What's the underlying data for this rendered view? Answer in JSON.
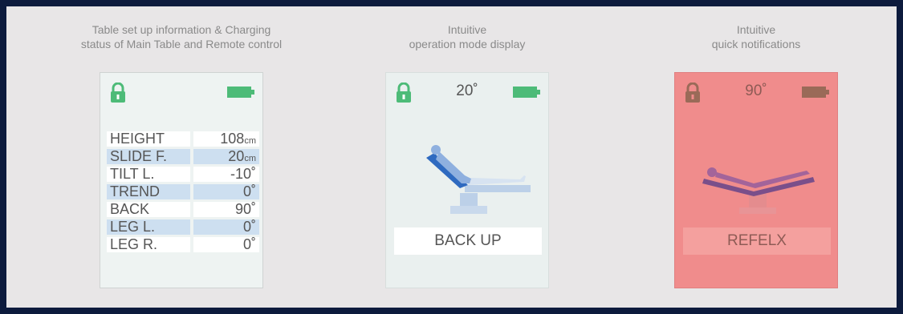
{
  "panels": [
    {
      "caption": [
        "Table set up information & Charging",
        "status of Main Table and Remote control"
      ],
      "rows": [
        {
          "label": "HEIGHT",
          "value": "108",
          "unit": "cm"
        },
        {
          "label": "SLIDE F.",
          "value": "20",
          "unit": "cm"
        },
        {
          "label": "TILT L.",
          "value": "-10˚",
          "unit": ""
        },
        {
          "label": "TREND",
          "value": "0˚",
          "unit": ""
        },
        {
          "label": "BACK",
          "value": "90˚",
          "unit": ""
        },
        {
          "label": "LEG L.",
          "value": "0˚",
          "unit": ""
        },
        {
          "label": "LEG R.",
          "value": "0˚",
          "unit": ""
        }
      ]
    },
    {
      "caption": [
        "Intuitive",
        "operation mode display"
      ],
      "angle": "20˚",
      "mode": "BACK UP"
    },
    {
      "caption": [
        "Intuitive",
        "quick notifications"
      ],
      "angle": "90˚",
      "mode": "REFELX"
    }
  ],
  "icons": {
    "lock": "lock-icon",
    "battery": "battery-icon",
    "chair": "operating-table-icon"
  },
  "colors": {
    "background": "#0d1b3d",
    "panel": "#e8e6e7",
    "accent_green": "#4dbb78",
    "alert_red": "#f08c8c",
    "row_blue": "#cddff0",
    "chair_blue": "#3a72c4"
  }
}
